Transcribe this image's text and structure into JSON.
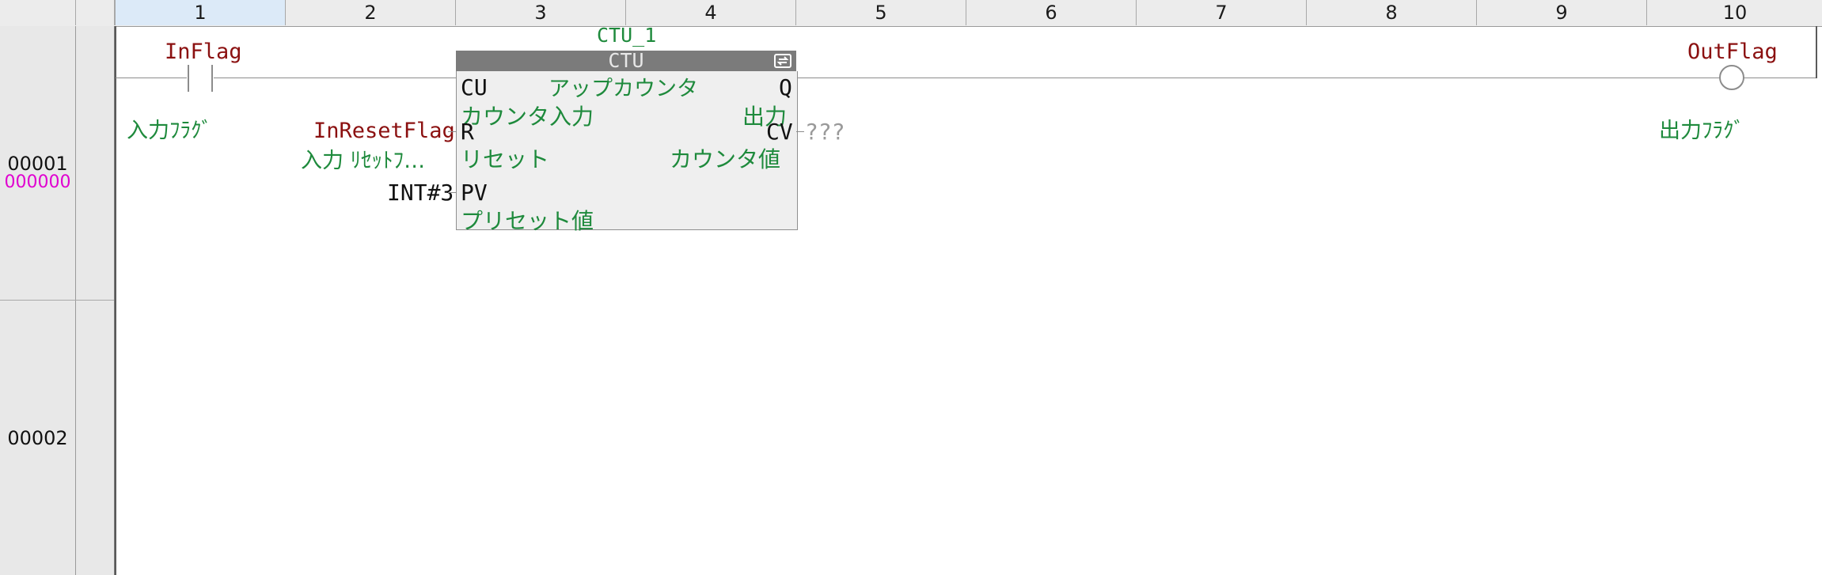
{
  "columns": [
    "1",
    "2",
    "3",
    "4",
    "5",
    "6",
    "7",
    "8",
    "9",
    "10"
  ],
  "rungs": [
    {
      "number": "00001",
      "step": "000000"
    },
    {
      "number": "00002"
    }
  ],
  "contact": {
    "variable": "InFlag",
    "comment": "入力ﾌﾗｸﾞ"
  },
  "coil": {
    "variable": "OutFlag",
    "comment": "出力ﾌﾗｸﾞ"
  },
  "block": {
    "instance": "CTU_1",
    "type": "CTU",
    "type_comment": "アップカウンタ",
    "refresh_icon": "refresh-icon",
    "pins": {
      "cu": {
        "label": "CU",
        "comment": "カウンタ入力"
      },
      "r": {
        "label": "R",
        "comment": "リセット",
        "input_var": "InResetFlag",
        "input_comment": "入力 ﾘｾｯﾄﾌ…"
      },
      "pv": {
        "label": "PV",
        "comment": "プリセット値",
        "input_value": "INT#3"
      },
      "q": {
        "label": "Q",
        "comment": "出力"
      },
      "cv": {
        "label": "CV",
        "comment": "カウンタ値",
        "output_var": "???"
      }
    }
  },
  "colors": {
    "variable": "#8b1010",
    "comment": "#1e8a3c",
    "step": "#e000d0",
    "block_title": "#7b7b7b"
  }
}
